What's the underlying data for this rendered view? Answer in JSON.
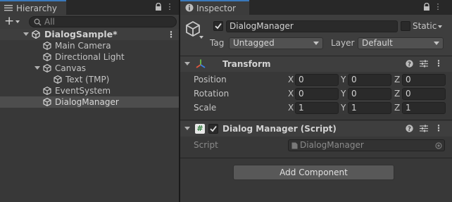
{
  "hierarchy": {
    "tab_label": "Hierarchy",
    "search_placeholder": "All",
    "scene_name": "DialogSample*",
    "items": [
      "Main Camera",
      "Directional Light",
      "Canvas",
      "Text (TMP)",
      "EventSystem",
      "DialogManager"
    ],
    "selected": "DialogManager"
  },
  "inspector": {
    "tab_label": "Inspector",
    "object_name": "DialogManager",
    "static_label": "Static",
    "tag_label": "Tag",
    "tag_value": "Untagged",
    "layer_label": "Layer",
    "layer_value": "Default",
    "transform": {
      "title": "Transform",
      "position_label": "Position",
      "rotation_label": "Rotation",
      "scale_label": "Scale",
      "x": "X",
      "y": "Y",
      "z": "Z",
      "position": [
        "0",
        "0",
        "0"
      ],
      "rotation": [
        "0",
        "0",
        "0"
      ],
      "scale": [
        "1",
        "1",
        "1"
      ]
    },
    "script_component": {
      "title": "Dialog Manager (Script)",
      "script_label": "Script",
      "script_value": "DialogManager",
      "hash_glyph": "#"
    },
    "add_component_label": "Add Component"
  },
  "glyphs": {
    "kebab": "⋮",
    "plus": "+",
    "help": "?"
  },
  "colors": {
    "tab_accent": "#3a79bb",
    "selected_row": "#4d4d4d",
    "panel": "#383838"
  }
}
